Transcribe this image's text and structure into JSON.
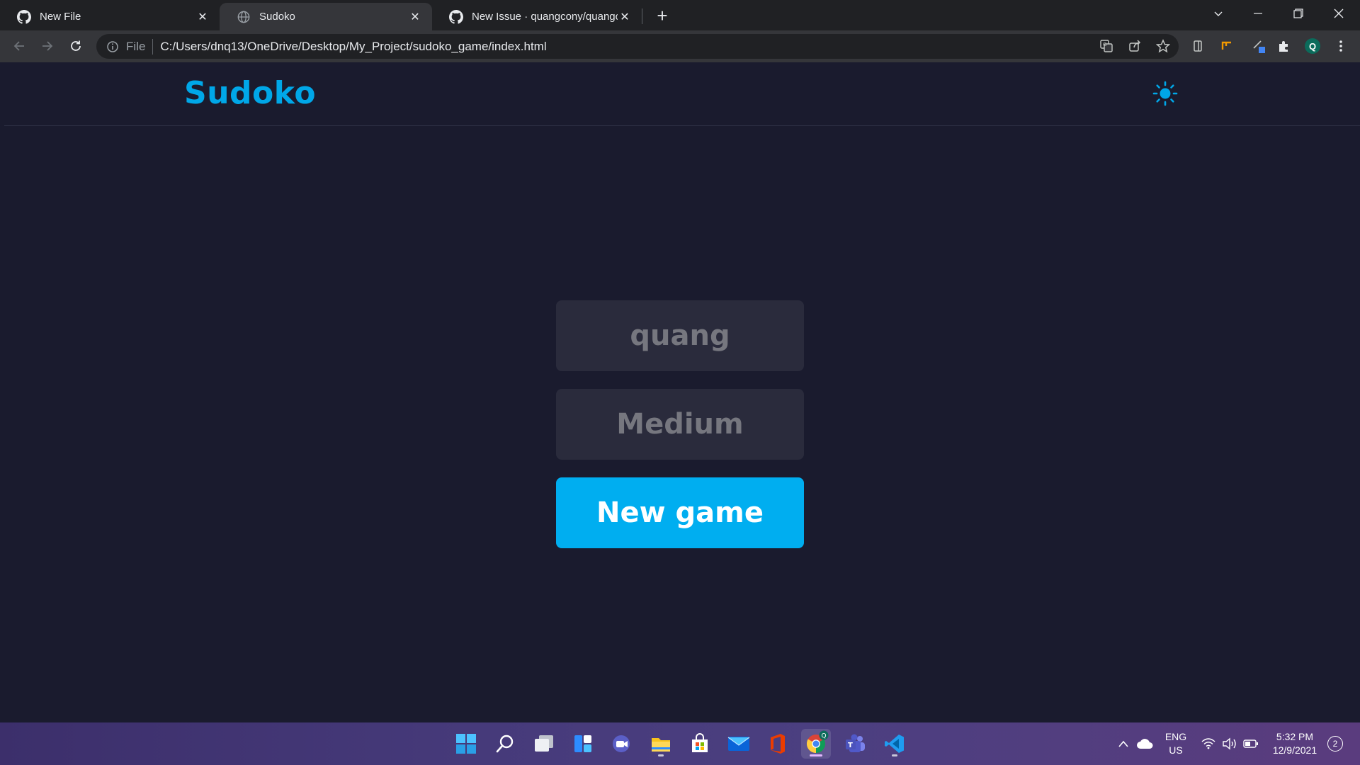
{
  "browser": {
    "tabs": [
      {
        "title": "New File",
        "icon": "github-icon",
        "active": false
      },
      {
        "title": "Sudoko",
        "icon": "globe-icon",
        "active": true
      },
      {
        "title": "New Issue · quangcony/quangcony",
        "icon": "github-icon",
        "active": false
      }
    ],
    "address": {
      "scheme": "File",
      "url": "C:/Users/dnq13/OneDrive/Desktop/My_Project/sudoko_game/index.html"
    },
    "profile_initial": "Q"
  },
  "page": {
    "logo": "Sudoko",
    "theme_icon": "sun-icon",
    "player_name": "quang",
    "level": "Medium",
    "new_game_label": "New game"
  },
  "taskbar": {
    "apps": [
      "windows-start",
      "search",
      "task-view",
      "widgets",
      "teams-chat",
      "file-explorer",
      "microsoft-store",
      "mail",
      "office",
      "chrome",
      "teams",
      "vscode"
    ],
    "language_line1": "ENG",
    "language_line2": "US",
    "time": "5:32 PM",
    "date": "12/9/2021",
    "notifications": "2"
  },
  "colors": {
    "accent": "#00aef0",
    "page_bg": "#1a1b2e",
    "panel_bg": "#2a2b3c"
  }
}
